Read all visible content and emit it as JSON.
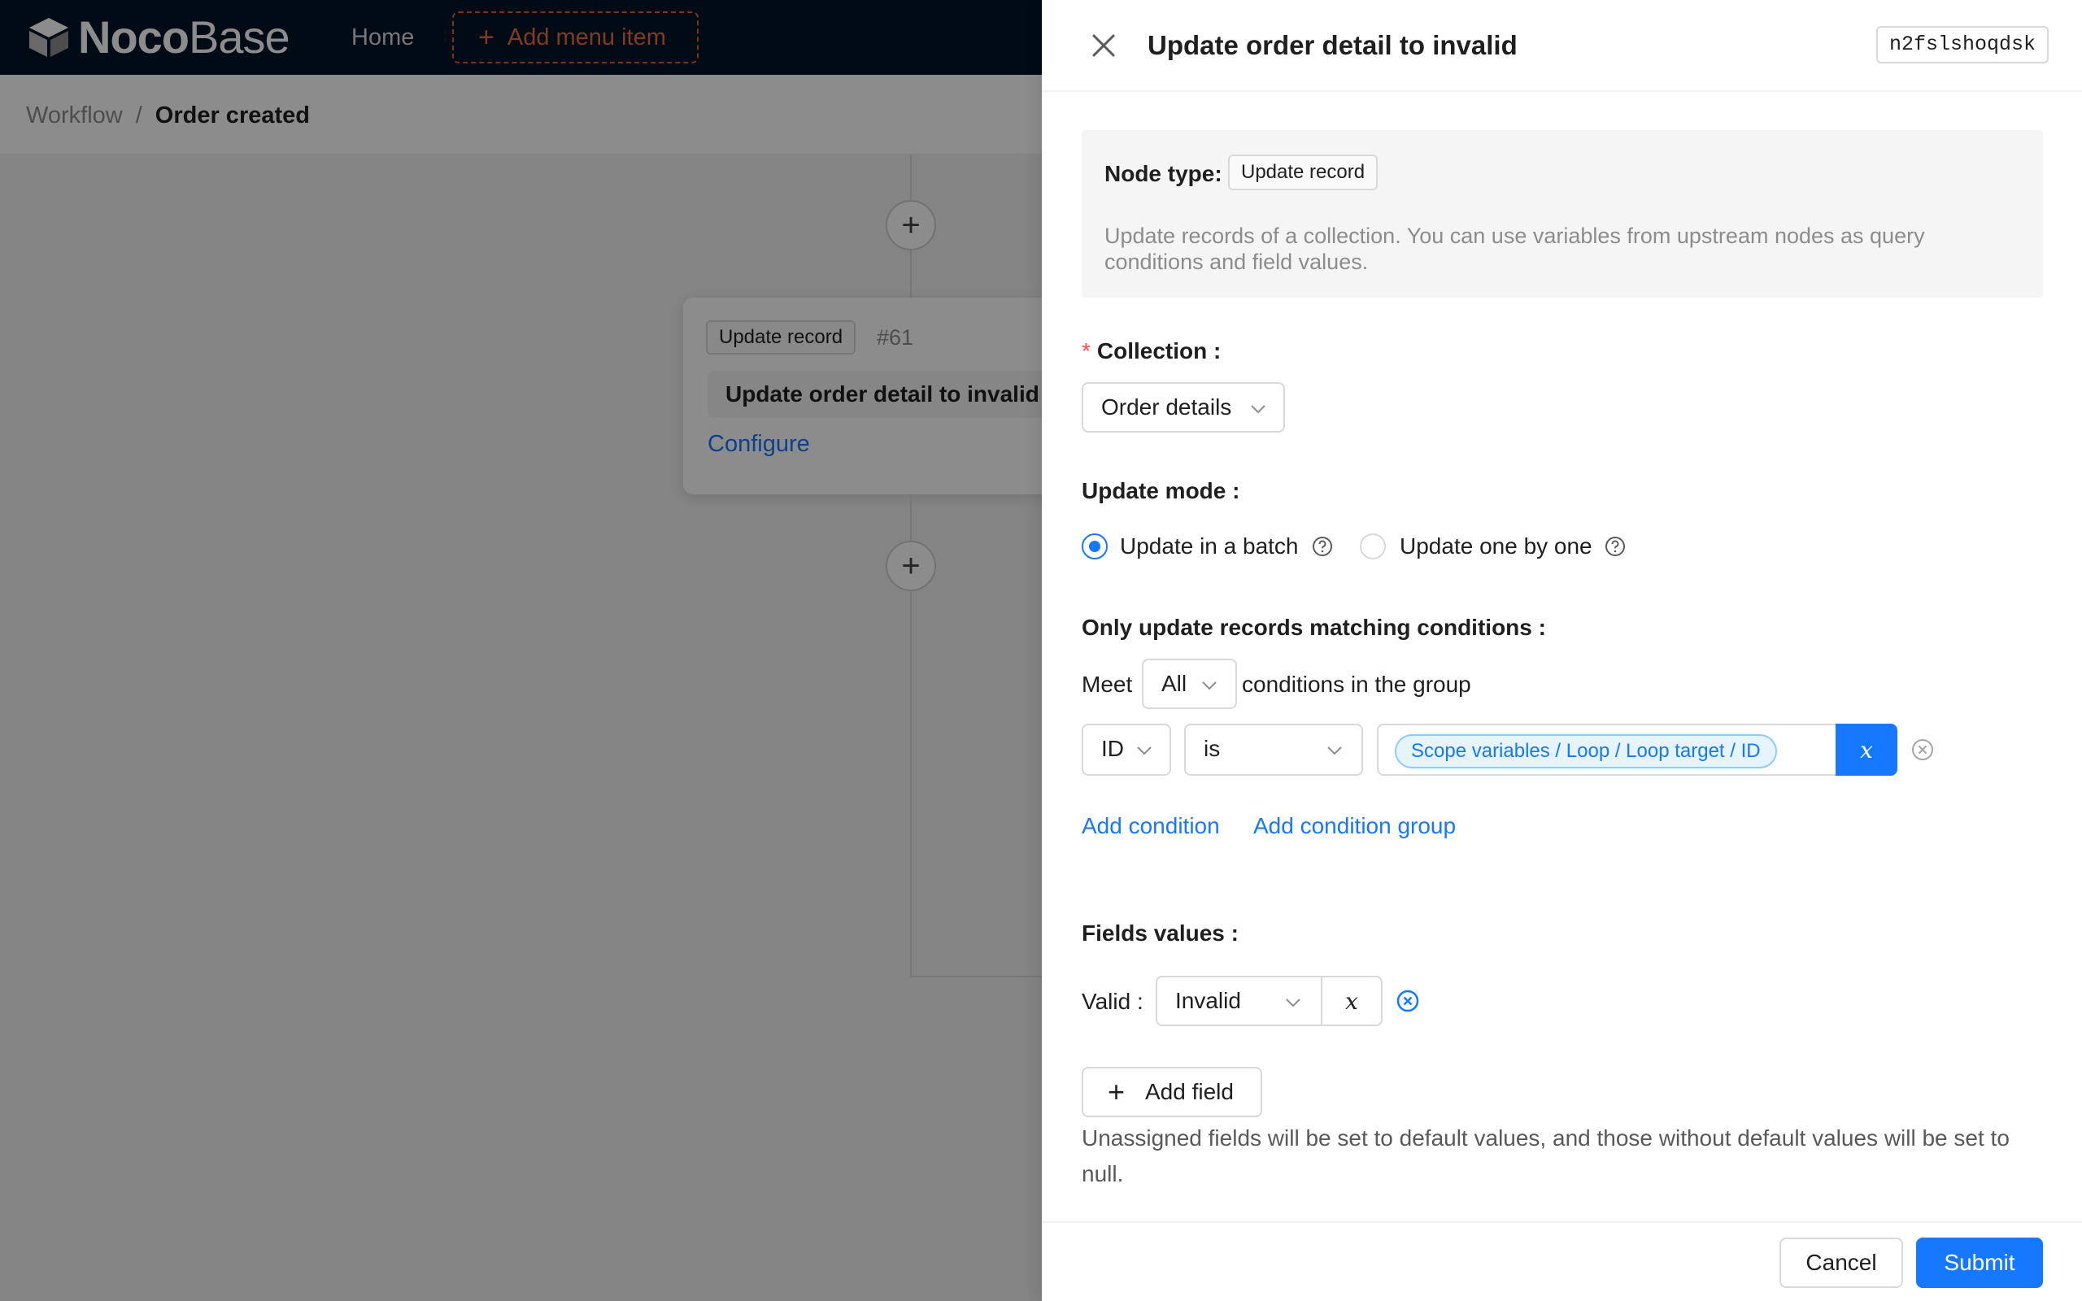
{
  "header": {
    "logo_bold": "Noco",
    "logo_light": "Base",
    "nav_home": "Home",
    "add_menu_item": "Add menu item"
  },
  "breadcrumb": {
    "parent": "Workflow",
    "separator": "/",
    "current": "Order created"
  },
  "canvas": {
    "node": {
      "type_tag": "Update record",
      "id": "#61",
      "title": "Update order detail to invalid",
      "configure": "Configure"
    }
  },
  "drawer": {
    "title": "Update order detail to invalid",
    "node_key": "n2fslshoqdsk",
    "node_type_label": "Node type:",
    "node_type_tag": "Update record",
    "node_description": "Update records of a collection. You can use variables from upstream nodes as query conditions and field values.",
    "collection": {
      "required_mark": "*",
      "label": "Collection :",
      "value": "Order details"
    },
    "update_mode": {
      "label": "Update mode :",
      "options": [
        {
          "label": "Update in a batch",
          "selected": true
        },
        {
          "label": "Update one by one",
          "selected": false
        }
      ]
    },
    "conditions": {
      "label": "Only update records matching conditions :",
      "meet_prefix": "Meet",
      "meet_value": "All",
      "meet_suffix": "conditions in the group",
      "rows": [
        {
          "field": "ID",
          "operator": "is",
          "value_tag": "Scope variables / Loop / Loop target / ID",
          "var_symbol": "x"
        }
      ],
      "add_condition": "Add condition",
      "add_condition_group": "Add condition group"
    },
    "fields_values": {
      "label": "Fields values :",
      "rows": [
        {
          "field_label": "Valid :",
          "value": "Invalid",
          "var_symbol": "x"
        }
      ],
      "add_field": "Add field",
      "help": "Unassigned fields will be set to default values, and those without default values will be set to null."
    },
    "footer": {
      "cancel": "Cancel",
      "submit": "Submit"
    }
  },
  "colors": {
    "header_bg": "#001529",
    "primary": "#1677ff",
    "add_menu_accent": "#e55e34",
    "required": "#ff4d4f"
  }
}
